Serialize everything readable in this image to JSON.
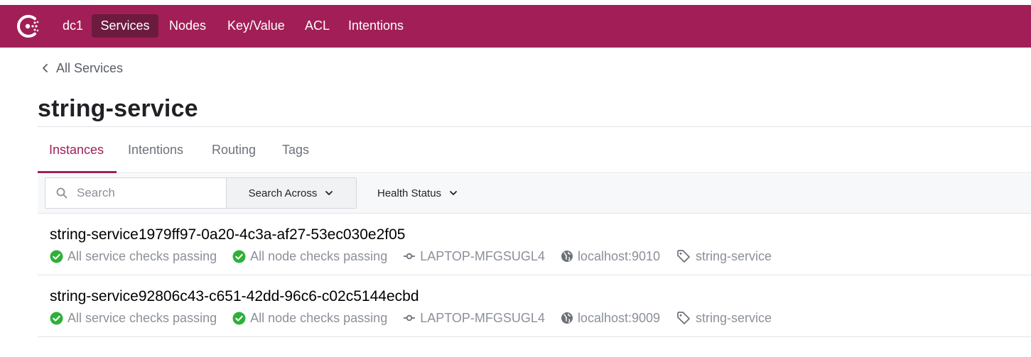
{
  "colors": {
    "brand": "#a11f56",
    "brand_dark": "#6d1a3f",
    "passing": "#2eb039"
  },
  "nav": {
    "datacenter": "dc1",
    "items": [
      "Services",
      "Nodes",
      "Key/Value",
      "ACL",
      "Intentions"
    ],
    "active": "Services"
  },
  "breadcrumb": {
    "label": "All Services"
  },
  "page": {
    "title": "string-service"
  },
  "tabs": [
    "Instances",
    "Intentions",
    "Routing",
    "Tags"
  ],
  "active_tab": "Instances",
  "toolbar": {
    "search_placeholder": "Search",
    "search_across_label": "Search Across",
    "health_status_label": "Health Status"
  },
  "instances": [
    {
      "name": "string-service1979ff97-0a20-4c3a-af27-53ec030e2f05",
      "service_checks": "All service checks passing",
      "node_checks": "All node checks passing",
      "node": "LAPTOP-MFGSUGL4",
      "address": "localhost:9010",
      "tag": "string-service"
    },
    {
      "name": "string-service92806c43-c651-42dd-96c6-c02c5144ecbd",
      "service_checks": "All service checks passing",
      "node_checks": "All node checks passing",
      "node": "LAPTOP-MFGSUGL4",
      "address": "localhost:9009",
      "tag": "string-service"
    }
  ]
}
